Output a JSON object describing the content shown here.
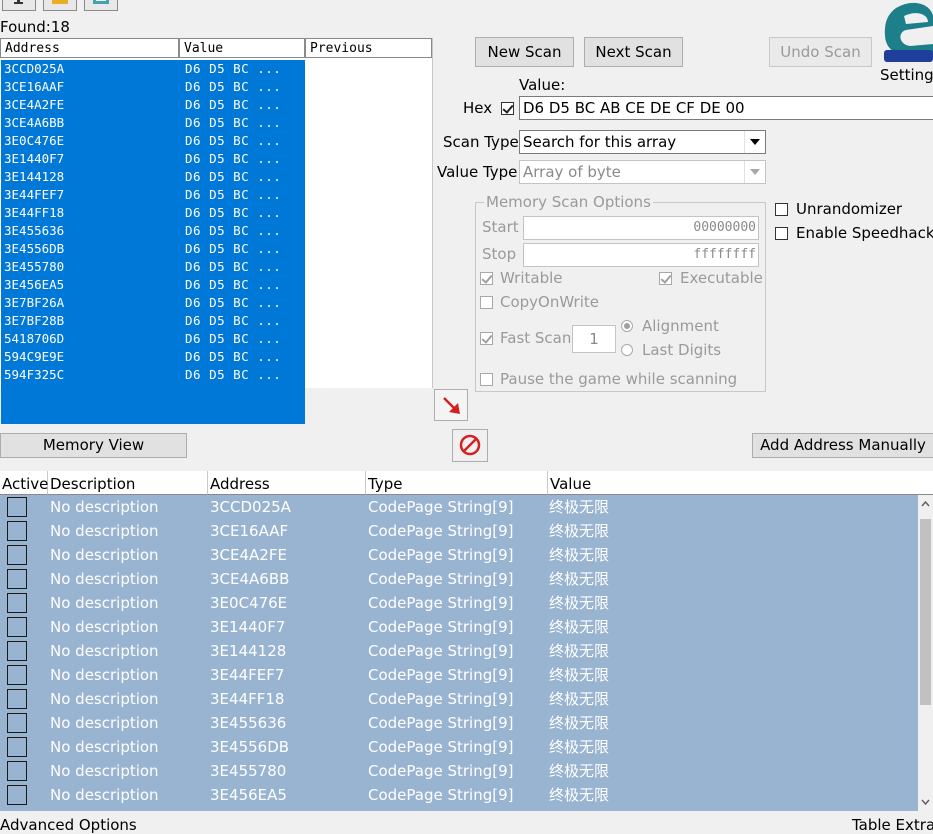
{
  "found": {
    "label": "Found:",
    "count": "18"
  },
  "found_list": {
    "headers": [
      "Address",
      "Value",
      "Previous"
    ],
    "rows": [
      {
        "address": "3CCD025A",
        "value": "D6 D5 BC ..."
      },
      {
        "address": "3CE16AAF",
        "value": "D6 D5 BC ..."
      },
      {
        "address": "3CE4A2FE",
        "value": "D6 D5 BC ..."
      },
      {
        "address": "3CE4A6BB",
        "value": "D6 D5 BC ..."
      },
      {
        "address": "3E0C476E",
        "value": "D6 D5 BC ..."
      },
      {
        "address": "3E1440F7",
        "value": "D6 D5 BC ..."
      },
      {
        "address": "3E144128",
        "value": "D6 D5 BC ..."
      },
      {
        "address": "3E44FEF7",
        "value": "D6 D5 BC ..."
      },
      {
        "address": "3E44FF18",
        "value": "D6 D5 BC ..."
      },
      {
        "address": "3E455636",
        "value": "D6 D5 BC ..."
      },
      {
        "address": "3E4556DB",
        "value": "D6 D5 BC ..."
      },
      {
        "address": "3E455780",
        "value": "D6 D5 BC ..."
      },
      {
        "address": "3E456EA5",
        "value": "D6 D5 BC ..."
      },
      {
        "address": "3E7BF26A",
        "value": "D6 D5 BC ..."
      },
      {
        "address": "3E7BF28B",
        "value": "D6 D5 BC ..."
      },
      {
        "address": "5418706D",
        "value": "D6 D5 BC ..."
      },
      {
        "address": "594C9E9E",
        "value": "D6 D5 BC ..."
      },
      {
        "address": "594F325C",
        "value": "D6 D5 BC ..."
      }
    ]
  },
  "scan": {
    "new_scan": "New Scan",
    "next_scan": "Next Scan",
    "undo_scan": "Undo Scan",
    "settings": "Setting",
    "value_label": "Value:",
    "hex_label": "Hex",
    "value_input": "D6 D5 BC AB CE DE CF DE 00",
    "scan_type_label": "Scan Type",
    "scan_type_value": "Search for this array",
    "value_type_label": "Value Type",
    "value_type_value": "Array of byte"
  },
  "memory_scan_options": {
    "title": "Memory Scan Options",
    "start_label": "Start",
    "start_value": "00000000",
    "stop_label": "Stop",
    "stop_value": "ffffffff",
    "writable": "Writable",
    "executable": "Executable",
    "copy_on_write": "CopyOnWrite",
    "fast_scan": "Fast Scan",
    "fast_scan_value": "1",
    "alignment": "Alignment",
    "last_digits": "Last Digits",
    "pause": "Pause the game while scanning"
  },
  "extra_options": {
    "unrandomizer": "Unrandomizer",
    "enable_speedhack": "Enable Speedhack"
  },
  "bottom_buttons": {
    "memory_view": "Memory View",
    "add_address": "Add Address Manually"
  },
  "address_table": {
    "headers": [
      "Active",
      "Description",
      "Address",
      "Type",
      "Value"
    ],
    "rows": [
      {
        "description": "No description",
        "address": "3CCD025A",
        "type": "CodePage String[9]",
        "value": "终极无限"
      },
      {
        "description": "No description",
        "address": "3CE16AAF",
        "type": "CodePage String[9]",
        "value": "终极无限"
      },
      {
        "description": "No description",
        "address": "3CE4A2FE",
        "type": "CodePage String[9]",
        "value": "终极无限"
      },
      {
        "description": "No description",
        "address": "3CE4A6BB",
        "type": "CodePage String[9]",
        "value": "终极无限"
      },
      {
        "description": "No description",
        "address": "3E0C476E",
        "type": "CodePage String[9]",
        "value": "终极无限"
      },
      {
        "description": "No description",
        "address": "3E1440F7",
        "type": "CodePage String[9]",
        "value": "终极无限"
      },
      {
        "description": "No description",
        "address": "3E144128",
        "type": "CodePage String[9]",
        "value": "终极无限"
      },
      {
        "description": "No description",
        "address": "3E44FEF7",
        "type": "CodePage String[9]",
        "value": "终极无限"
      },
      {
        "description": "No description",
        "address": "3E44FF18",
        "type": "CodePage String[9]",
        "value": "终极无限"
      },
      {
        "description": "No description",
        "address": "3E455636",
        "type": "CodePage String[9]",
        "value": "终极无限"
      },
      {
        "description": "No description",
        "address": "3E4556DB",
        "type": "CodePage String[9]",
        "value": "终极无限"
      },
      {
        "description": "No description",
        "address": "3E455780",
        "type": "CodePage String[9]",
        "value": "终极无限"
      },
      {
        "description": "No description",
        "address": "3E456EA5",
        "type": "CodePage String[9]",
        "value": "终极无限"
      }
    ]
  },
  "footer": {
    "advanced_options": "Advanced Options",
    "table_extras": "Table Extras"
  },
  "colors": {
    "selection_blue": "#0078d7",
    "table_row_blue": "#99b4d1",
    "arrow_red": "#d42020"
  },
  "icons": [
    "open-process-icon",
    "open-file-icon",
    "save-icon",
    "cheat-engine-logo-icon",
    "copy-to-table-arrow-icon",
    "clear-list-icon"
  ]
}
